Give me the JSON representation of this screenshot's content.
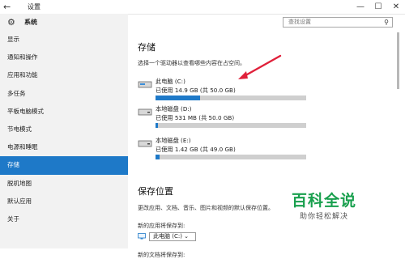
{
  "window": {
    "title": "设置",
    "controls": [
      "—",
      "☐",
      "✕"
    ]
  },
  "sidebar": {
    "section": "系统",
    "items": [
      {
        "label": "显示"
      },
      {
        "label": "通知和操作"
      },
      {
        "label": "应用和功能"
      },
      {
        "label": "多任务"
      },
      {
        "label": "平板电脑模式"
      },
      {
        "label": "节电模式"
      },
      {
        "label": "电源和睡眠"
      },
      {
        "label": "存储",
        "active": true
      },
      {
        "label": "脱机地图"
      },
      {
        "label": "默认应用"
      },
      {
        "label": "关于"
      }
    ]
  },
  "search": {
    "placeholder": "查找设置"
  },
  "storage": {
    "heading": "存储",
    "description": "选择一个驱动器以查看哪些内容在占空间。",
    "drives": [
      {
        "name": "此电脑 (C:)",
        "usage": "已使用 14.9 GB (共 50.0 GB)",
        "used_fraction": 0.298
      },
      {
        "name": "本地磁盘 (D:)",
        "usage": "已使用 531 MB (共 50.0 GB)",
        "used_fraction": 0.011
      },
      {
        "name": "本地磁盘 (E:)",
        "usage": "已使用 1.42 GB (共 49.0 GB)",
        "used_fraction": 0.029
      }
    ]
  },
  "save_locations": {
    "heading": "保存位置",
    "description": "更改应用、文档、音乐、图片和视频的默认保存位置。",
    "apps_label": "新的应用将保存到:",
    "apps_value": "此电脑 (C:)",
    "docs_label": "新的文档将保存到:"
  },
  "watermark": {
    "title": "百科全说",
    "subtitle": "助你轻松解决"
  },
  "colors": {
    "accent": "#1e79c8",
    "sidebar_bg": "#f2f2f2",
    "arrow": "#e0203a",
    "watermark": "#19a04e"
  }
}
